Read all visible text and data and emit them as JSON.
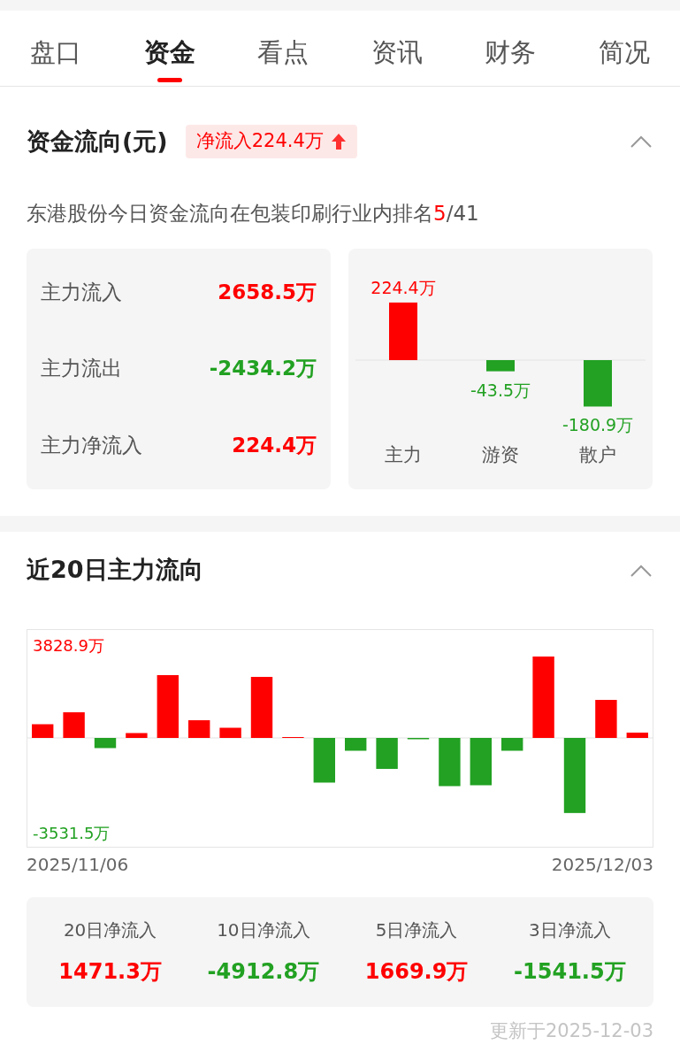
{
  "tabs": [
    {
      "label": "盘口",
      "selected": false
    },
    {
      "label": "资金",
      "selected": true
    },
    {
      "label": "看点",
      "selected": false
    },
    {
      "label": "资讯",
      "selected": false
    },
    {
      "label": "财务",
      "selected": false
    },
    {
      "label": "简况",
      "selected": false
    }
  ],
  "fund_flow": {
    "title": "资金流向(元)",
    "expanded": true,
    "badge": {
      "text": "净流入224.4万",
      "rising": true
    },
    "ranking": {
      "text": "东港股份今日资金流向在包装印刷行业内排名",
      "rank": "5",
      "total": "/41"
    },
    "stats": [
      {
        "label": "主力流入",
        "value": "2658.5万",
        "color": "#ff0000"
      },
      {
        "label": "主力流出",
        "value": "-2434.2万",
        "color": "#22a122"
      },
      {
        "label": "主力净流入",
        "value": "224.4万",
        "color": "#ff0000"
      }
    ],
    "chart_data": {
      "type": "bar",
      "categories": [
        "主力",
        "游资",
        "散户"
      ],
      "values": [
        224.4,
        -43.5,
        -180.9
      ],
      "value_labels": [
        "224.4万",
        "-43.5万",
        "-180.9万"
      ]
    }
  },
  "main_flow_20d": {
    "title": "近20日主力流向",
    "expanded": true,
    "chart": {
      "max_label": "3828.9万",
      "min_label": "-3531.5万"
    },
    "date_range": {
      "start": "2025/11/06",
      "end": "2025/12/03"
    },
    "summary": [
      {
        "label": "20日净流入",
        "value": "1471.3万",
        "color": "#ff0000"
      },
      {
        "label": "10日净流入",
        "value": "-4912.8万",
        "color": "#22a122"
      },
      {
        "label": "5日净流入",
        "value": "1669.9万",
        "color": "#ff0000"
      },
      {
        "label": "3日净流入",
        "value": "-1541.5万",
        "color": "#22a122"
      }
    ],
    "updated": "更新于2025-12-03"
  }
}
